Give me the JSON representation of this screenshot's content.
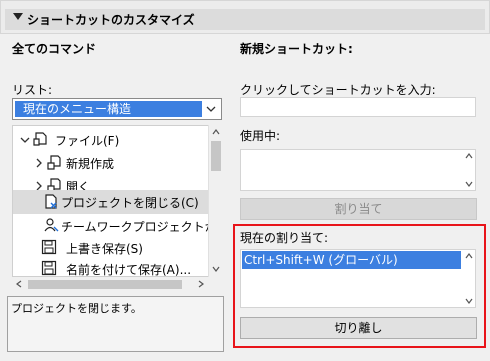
{
  "section": {
    "title": "ショートカットのカスタマイズ"
  },
  "left": {
    "column_title": "全てのコマンド",
    "list_label": "リスト:",
    "list_dropdown_value": "現在のメニュー構造",
    "tree_items": [
      {
        "label": "ファイル(F)",
        "icon": "folder-file-icon",
        "expander": "expanded"
      },
      {
        "label": "新規作成",
        "icon": "new-document-icon",
        "expander": "collapsed"
      },
      {
        "label": "開く",
        "icon": "open-folder-icon",
        "expander": "collapsed"
      },
      {
        "label": "プロジェクトを閉じる(C)",
        "icon": "close-project-icon",
        "expander": "none",
        "selected": true
      },
      {
        "label": "チームワークプロジェクトから退出",
        "icon": "teamwork-user-icon",
        "expander": "none"
      },
      {
        "label": "上書き保存(S)",
        "icon": "save-disk-icon",
        "expander": "none"
      },
      {
        "label": "名前を付けて保存(A)...",
        "icon": "save-as-disk-icon",
        "expander": "none"
      }
    ],
    "description": "プロジェクトを閉じます。"
  },
  "right": {
    "column_title": "新規ショートカット:",
    "input_label": "クリックしてショートカットを入力:",
    "in_use_label": "使用中:",
    "assign_button": "割り当て",
    "current_assignment_label": "現在の割り当て:",
    "current_assignments": [
      "Ctrl+Shift+W (グローバル)"
    ],
    "detach_button": "切り離し"
  },
  "colors": {
    "selection_blue": "#3c7fe0",
    "highlight_red": "#e8141a"
  }
}
